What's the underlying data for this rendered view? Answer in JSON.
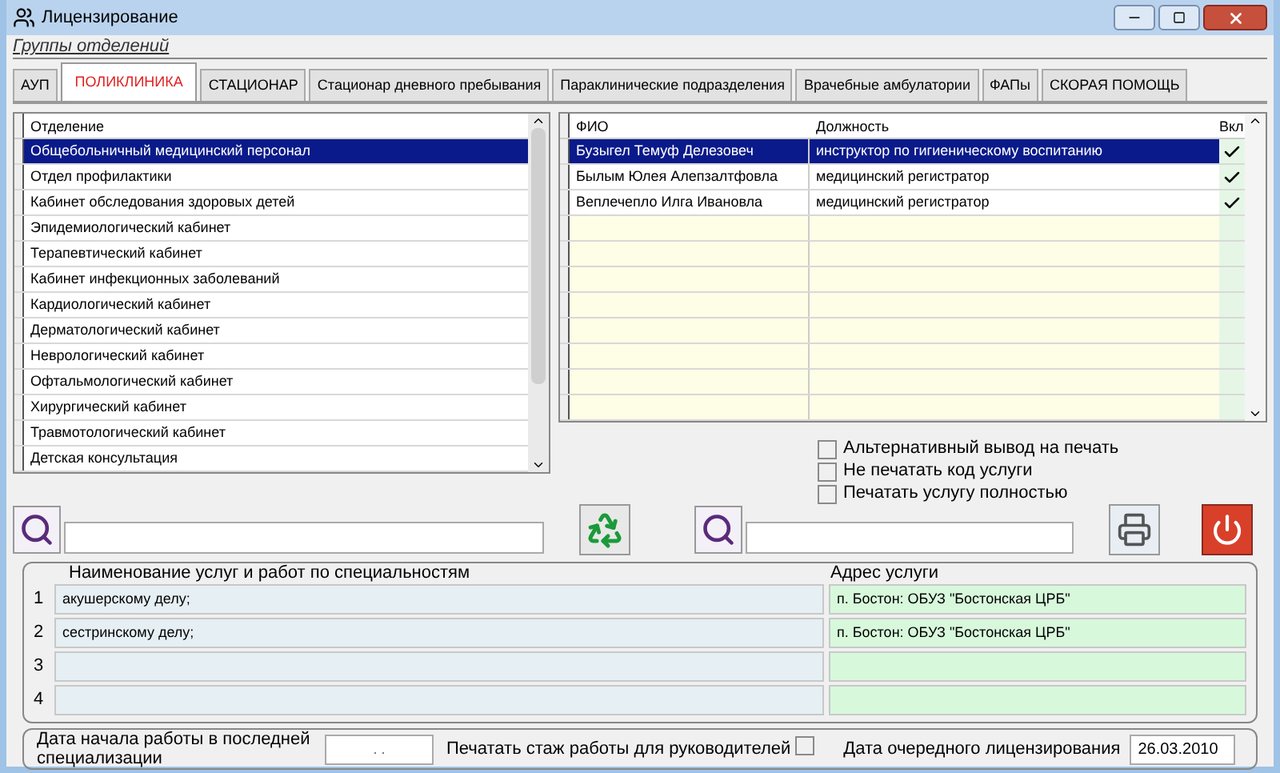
{
  "window": {
    "title": "Лицензирование"
  },
  "group_label": "Группы отделений",
  "tabs": [
    {
      "label": "АУП",
      "selected": false
    },
    {
      "label": "ПОЛИКЛИНИКА",
      "selected": true
    },
    {
      "label": "СТАЦИОНАР",
      "selected": false
    },
    {
      "label": "Стационар дневного пребывания",
      "selected": false
    },
    {
      "label": "Параклинические подразделения",
      "selected": false
    },
    {
      "label": "Врачебные амбулатории",
      "selected": false
    },
    {
      "label": "ФАПы",
      "selected": false
    },
    {
      "label": "СКОРАЯ ПОМОЩЬ",
      "selected": false
    }
  ],
  "departments": {
    "column": "Отделение",
    "rows": [
      {
        "name": "Общебольничный медицинский персонал",
        "selected": true
      },
      {
        "name": "Отдел профилактики",
        "selected": false
      },
      {
        "name": "Кабинет обследования здоровых детей",
        "selected": false
      },
      {
        "name": "Эпидемиологический кабинет",
        "selected": false
      },
      {
        "name": "Терапевтический кабинет",
        "selected": false
      },
      {
        "name": "Кабинет инфекционных заболеваний",
        "selected": false
      },
      {
        "name": "Кардиологический кабинет",
        "selected": false
      },
      {
        "name": "Дерматологический кабинет",
        "selected": false
      },
      {
        "name": "Неврологический кабинет",
        "selected": false
      },
      {
        "name": "Офтальмологический кабинет",
        "selected": false
      },
      {
        "name": "Хирургический кабинет",
        "selected": false
      },
      {
        "name": "Травмотологический кабинет",
        "selected": false
      },
      {
        "name": "Детская консультация",
        "selected": false
      }
    ]
  },
  "staff": {
    "columns": [
      "ФИО",
      "Должность",
      "Вкл"
    ],
    "rows": [
      {
        "name": "Бузыгел Темуф Делезовеч",
        "position": "инструктор по гигиеническому воспитанию",
        "included": true,
        "selected": true
      },
      {
        "name": "Былым Юлея Алепзалтфовла",
        "position": "медицинский регистратор",
        "included": true,
        "selected": false
      },
      {
        "name": "Веплечепло Илга Ивановла",
        "position": "медицинский регистратор",
        "included": true,
        "selected": false
      }
    ]
  },
  "print_options": [
    {
      "label": "Альтернативный вывод на печать",
      "checked": false
    },
    {
      "label": "Не печатать код услуги",
      "checked": false
    },
    {
      "label": "Печатать услугу полностью",
      "checked": false
    }
  ],
  "services": {
    "columns": [
      "Наименование услуг и работ по специальностям",
      "Адрес услуги"
    ],
    "rows": [
      {
        "number": "1",
        "name": "акушерскому делу;",
        "address": "п. Бостон: ОБУЗ \"Бостонская ЦРБ\""
      },
      {
        "number": "2",
        "name": "сестринскому делу;",
        "address": "п. Бостон: ОБУЗ \"Бостонская ЦРБ\""
      },
      {
        "number": "3"
      },
      {
        "number": "4"
      }
    ]
  },
  "footer": {
    "start_date_label": "Дата начала работы в последней специализации",
    "start_date_value": ". .",
    "print_experience_label": "Печатать стаж работы для руководителей",
    "print_experience_checked": false,
    "next_license_label": "Дата очередного лицензирования",
    "next_license_value": "26.03.2010"
  }
}
